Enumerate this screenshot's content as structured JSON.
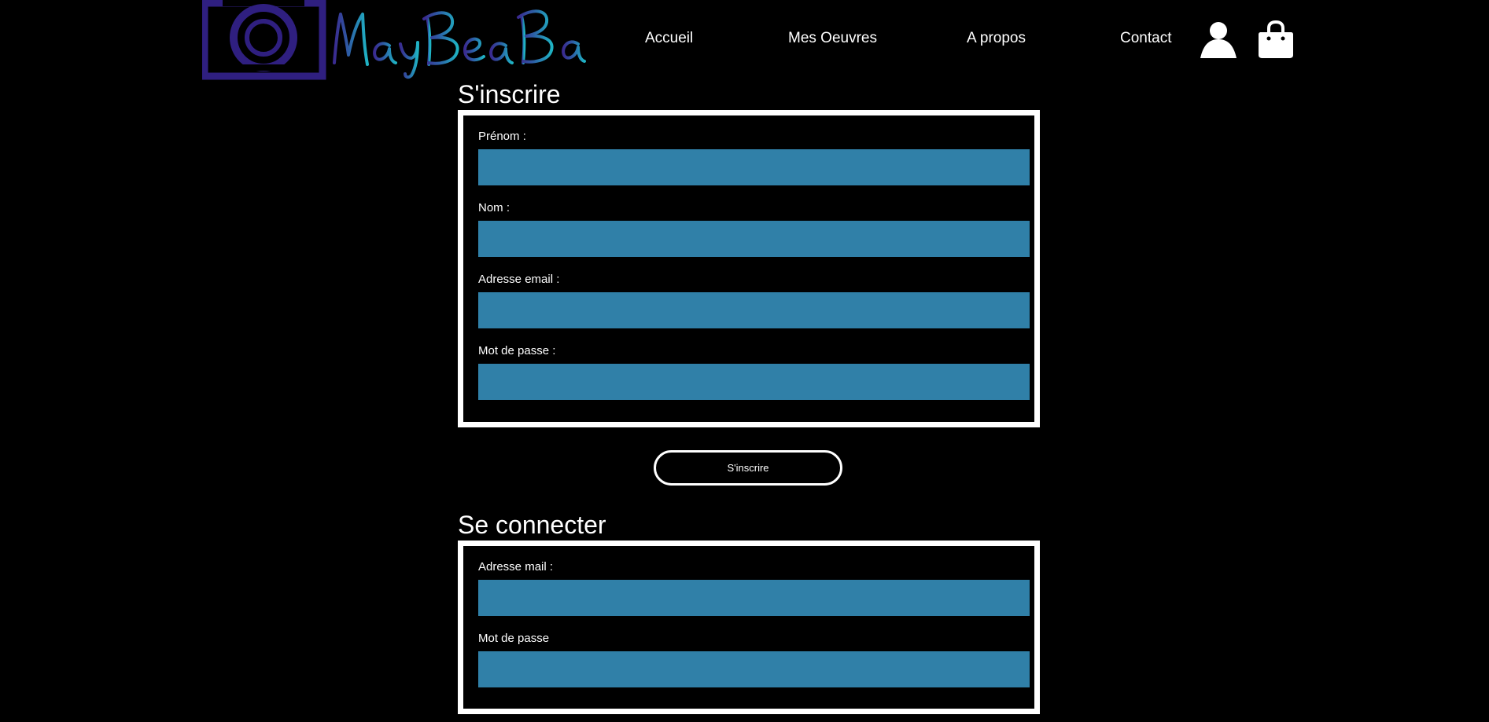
{
  "header": {
    "logo_text": "MayBeaBa",
    "nav": {
      "accueil": "Accueil",
      "oeuvres": "Mes Oeuvres",
      "apropos": "A propos",
      "contact": "Contact"
    },
    "icons": [
      "user-icon",
      "shopping-bag-icon"
    ]
  },
  "register": {
    "title": "S'inscrire",
    "fields": [
      {
        "label": "Prénom :",
        "value": ""
      },
      {
        "label": "Nom :",
        "value": ""
      },
      {
        "label": "Adresse email :",
        "value": ""
      },
      {
        "label": "Mot de passe :",
        "value": ""
      }
    ],
    "submit_label": "S'inscrire"
  },
  "login": {
    "title": "Se connecter",
    "fields": [
      {
        "label": "Adresse mail :",
        "value": ""
      },
      {
        "label": "Mot de passe",
        "value": ""
      }
    ]
  },
  "colors": {
    "background": "#000000",
    "input_fill": "#3080a8",
    "border": "#ffffff",
    "logo_dark": "#2f1f80",
    "logo_light": "#1fb0c0"
  }
}
